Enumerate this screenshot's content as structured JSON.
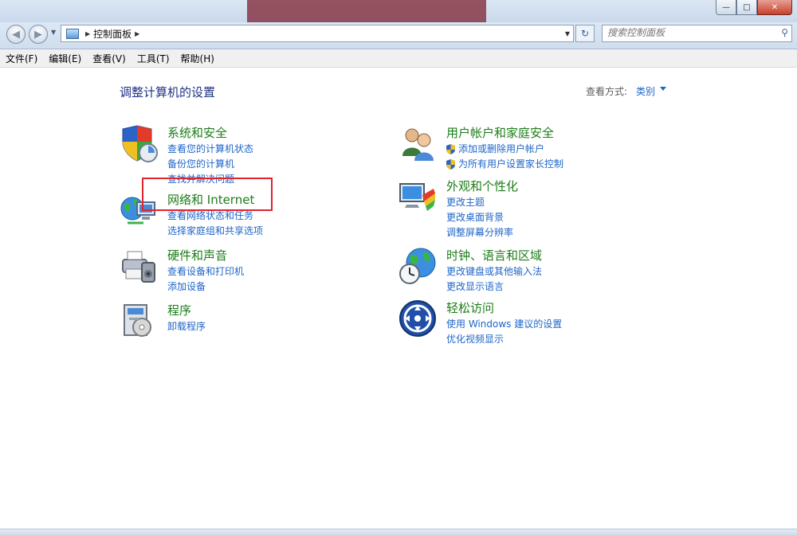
{
  "window": {
    "title": "",
    "title_bar_accent": "#7d2230",
    "buttons": {
      "minimize": "—",
      "maximize": "□",
      "close": "✕"
    }
  },
  "navigation": {
    "back_icon": "◀",
    "forward_icon": "▶",
    "breadcrumb": [
      "控制面板"
    ],
    "search_placeholder": "搜索控制面板"
  },
  "menu": [
    "文件(F)",
    "编辑(E)",
    "查看(V)",
    "工具(T)",
    "帮助(H)"
  ],
  "main": {
    "title": "调整计算机的设置",
    "view_by_label": "查看方式:",
    "view_by_value": "类别"
  },
  "categories": [
    {
      "title": "系统和安全",
      "links": [
        "查看您的计算机状态",
        "备份您的计算机",
        "查找并解决问题"
      ],
      "icon": "security-shield-icon"
    },
    {
      "title": "网络和 Internet",
      "links": [
        "查看网络状态和任务",
        "选择家庭组和共享选项"
      ],
      "icon": "network-globe-icon"
    },
    {
      "title": "硬件和声音",
      "links": [
        "查看设备和打印机",
        "添加设备"
      ],
      "icon": "printer-icon"
    },
    {
      "title": "程序",
      "links": [
        "卸载程序"
      ],
      "icon": "programs-icon"
    },
    {
      "title": "用户帐户和家庭安全",
      "links": [
        "添加或删除用户帐户",
        "为所有用户设置家长控制"
      ],
      "icon": "users-icon"
    },
    {
      "title": "外观和个性化",
      "links": [
        "更改主题",
        "更改桌面背景",
        "调整屏幕分辨率"
      ],
      "icon": "display-palette-icon"
    },
    {
      "title": "时钟、语言和区域",
      "links": [
        "更改键盘或其他输入法",
        "更改显示语言"
      ],
      "icon": "globe-clock-icon"
    },
    {
      "title": "轻松访问",
      "links": [
        "使用 Windows 建议的设置",
        "优化视频显示"
      ],
      "icon": "ease-of-access-icon"
    }
  ],
  "colors": {
    "category_title": "#1c7d19",
    "link": "#1e65c8",
    "page_title": "#1e3287",
    "highlight_box": "#e0232d"
  }
}
